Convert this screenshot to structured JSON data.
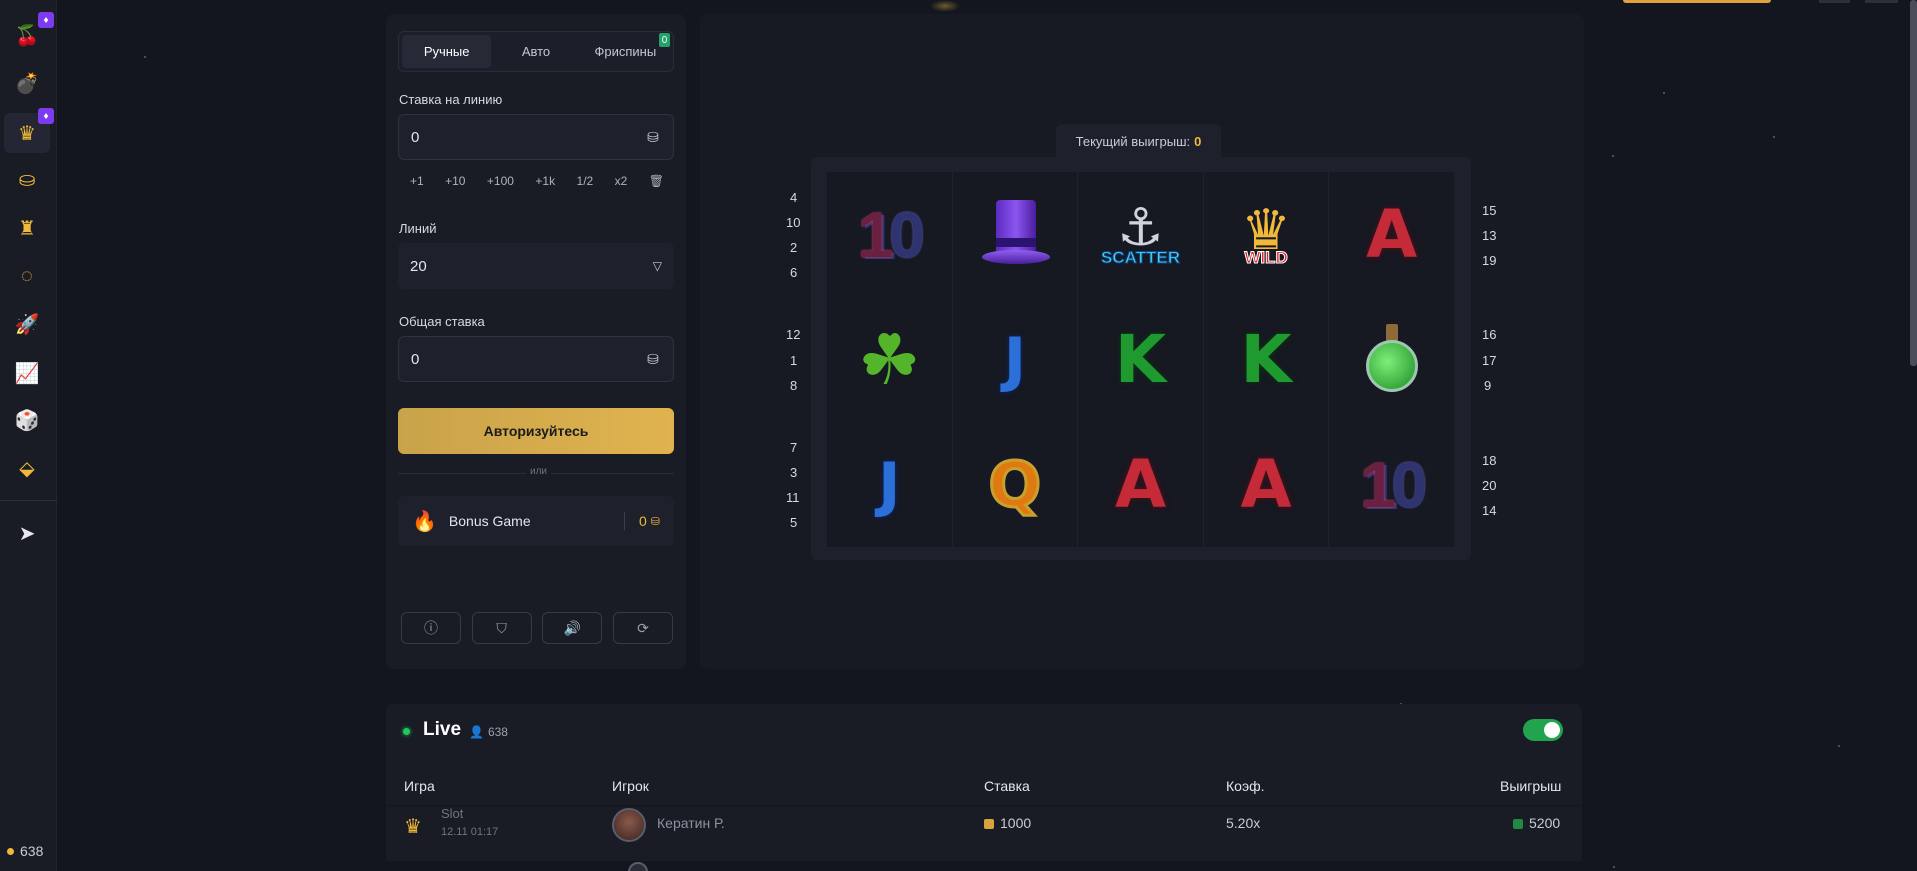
{
  "sidebar": {
    "items": [
      {
        "icon": "cherry-icon",
        "glyph": "🍒",
        "badge": "♦"
      },
      {
        "icon": "bomb-icon",
        "glyph": "💣"
      },
      {
        "icon": "crown-icon",
        "glyph": "♛",
        "badge": "♦"
      },
      {
        "icon": "coins-stack-icon",
        "glyph": "⛀"
      },
      {
        "icon": "tower-icon",
        "glyph": "♜"
      },
      {
        "icon": "wheel-icon",
        "glyph": "◌"
      },
      {
        "icon": "rocket-icon",
        "glyph": "🚀"
      },
      {
        "icon": "chart-icon",
        "glyph": "📈"
      },
      {
        "icon": "dice-icon",
        "glyph": "🎲"
      },
      {
        "icon": "grid-icon",
        "glyph": "⬙"
      }
    ],
    "telegram_icon": "➤",
    "online_count": "638"
  },
  "tabs": [
    {
      "label": "Ручные",
      "active": true
    },
    {
      "label": "Авто",
      "active": false
    },
    {
      "label": "Фриспины",
      "active": false,
      "badge": "0"
    }
  ],
  "bet_per_line": {
    "label": "Ставка на линию",
    "value": "0"
  },
  "quick_buttons": [
    "+1",
    "+10",
    "+100",
    "+1k",
    "1/2",
    "x2"
  ],
  "trash_glyph": "🗑",
  "lines": {
    "label": "Линий",
    "value": "20"
  },
  "total_bet": {
    "label": "Общая ставка",
    "value": "0"
  },
  "auth_button": "Авторизуйтесь",
  "or_text": "или",
  "bonus": {
    "label": "Bonus Game",
    "value": "0"
  },
  "controls": [
    "ⓘ",
    "⛉",
    "🔊",
    "⟳"
  ],
  "current_win": {
    "label": "Текущий выигрыш:",
    "value": "0"
  },
  "reels": [
    [
      "10",
      "clover",
      "J-blue"
    ],
    [
      "hat",
      "J-blue",
      "Q-orange"
    ],
    [
      "scatter",
      "K-green",
      "A-red"
    ],
    [
      "wild",
      "K-green",
      "A-red"
    ],
    [
      "A-red",
      "potion",
      "10"
    ]
  ],
  "scatter_text": "SCATTER",
  "wild_text": "WILD",
  "left_line_numbers": [
    "4",
    "10",
    "2",
    "6",
    "12",
    "1",
    "8",
    "7",
    "3",
    "11",
    "5"
  ],
  "right_line_numbers": [
    "15",
    "13",
    "19",
    "16",
    "17",
    "9",
    "18",
    "20",
    "14"
  ],
  "live": {
    "title": "Live",
    "count": "638",
    "headers": {
      "game": "Игра",
      "player": "Игрок",
      "bet": "Ставка",
      "coef": "Коэф.",
      "win": "Выигрыш"
    },
    "rows": [
      {
        "game": "Slot",
        "time": "12.11 01:17",
        "player": "Кератин Р.",
        "bet": "1000",
        "coef": "5.20x",
        "win": "5200"
      }
    ]
  }
}
